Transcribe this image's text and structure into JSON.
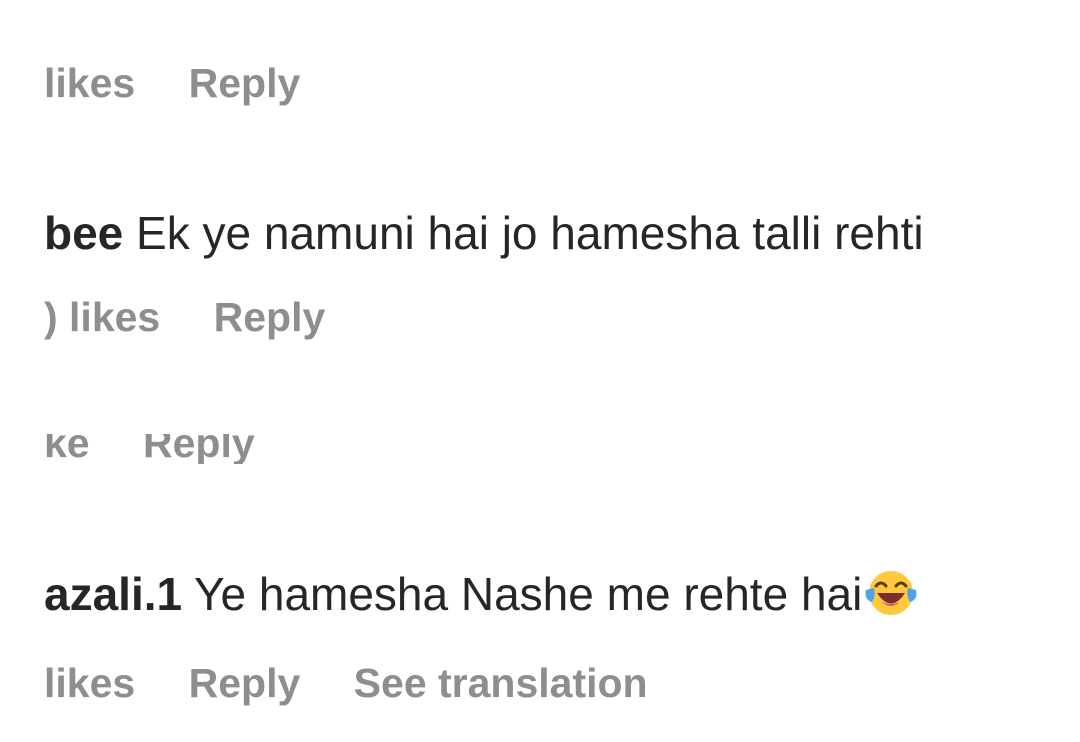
{
  "comments": [
    {
      "meta": {
        "likes": "likes",
        "reply": "Reply"
      }
    },
    {
      "username": "bee",
      "text": "Ek ye namuni hai jo hamesha talli rehti",
      "meta": {
        "likes": ") likes",
        "reply": "Reply"
      }
    },
    {
      "meta": {
        "likes": "ke",
        "reply": "Reply"
      }
    },
    {
      "username": "azali.1",
      "text": "Ye hamesha Nashe me rehte hai",
      "emoji": "face-with-tears-of-joy-icon",
      "meta": {
        "likes": "likes",
        "reply": "Reply",
        "translate": "See translation"
      }
    }
  ],
  "colors": {
    "text": "#262626",
    "meta": "#8e8e8e",
    "emoji_face": "#FFC83D",
    "emoji_tear": "#4FA3E8",
    "emoji_mouth": "#7A2E2E"
  }
}
